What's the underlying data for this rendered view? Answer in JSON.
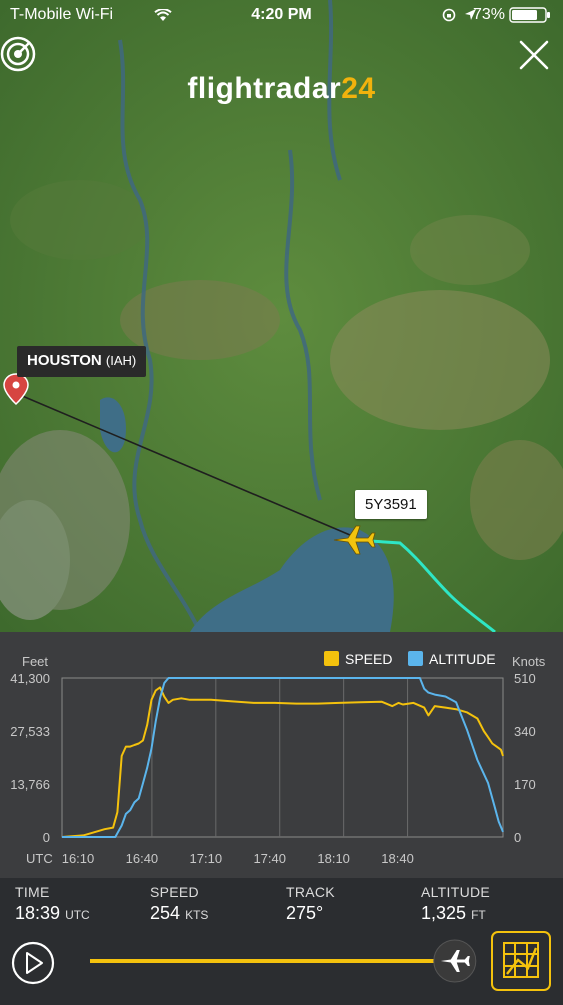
{
  "status_bar": {
    "carrier": "T-Mobile Wi-Fi",
    "time": "4:20 PM",
    "battery": "73%"
  },
  "header": {
    "logo_text": "flightradar",
    "logo_number": "24"
  },
  "map": {
    "airport_name": "HOUSTON",
    "airport_code": "(IAH)",
    "flight_label": "5Y3591",
    "track_color": "#2ee6c6",
    "plane_color": "#f1c40f"
  },
  "chart_data": {
    "type": "line",
    "x": [
      "16:10",
      "16:40",
      "17:10",
      "17:40",
      "18:10",
      "18:40"
    ],
    "xlabel": "UTC",
    "ylabel_left": "Feet",
    "ylabel_right": "Knots",
    "left_ticks": [
      "41,300",
      "27,533",
      "13,766",
      "0"
    ],
    "right_ticks": [
      "510",
      "340",
      "170",
      "0"
    ],
    "ylim_left": [
      0,
      41300
    ],
    "ylim_right": [
      0,
      510
    ],
    "series": [
      {
        "name": "SPEED",
        "color": "#f4c20d",
        "axis": "right",
        "points": [
          [
            0,
            0
          ],
          [
            10,
            5
          ],
          [
            15,
            15
          ],
          [
            20,
            25
          ],
          [
            24,
            30
          ],
          [
            26,
            80
          ],
          [
            28,
            260
          ],
          [
            30,
            290
          ],
          [
            32,
            290
          ],
          [
            34,
            295
          ],
          [
            36,
            300
          ],
          [
            38,
            310
          ],
          [
            40,
            360
          ],
          [
            42,
            440
          ],
          [
            44,
            470
          ],
          [
            46,
            480
          ],
          [
            48,
            450
          ],
          [
            50,
            430
          ],
          [
            52,
            440
          ],
          [
            56,
            445
          ],
          [
            60,
            440
          ],
          [
            70,
            440
          ],
          [
            80,
            435
          ],
          [
            90,
            430
          ],
          [
            100,
            430
          ],
          [
            110,
            428
          ],
          [
            120,
            428
          ],
          [
            130,
            430
          ],
          [
            140,
            432
          ],
          [
            150,
            434
          ],
          [
            155,
            420
          ],
          [
            158,
            430
          ],
          [
            160,
            425
          ],
          [
            165,
            430
          ],
          [
            170,
            415
          ],
          [
            172,
            390
          ],
          [
            175,
            420
          ],
          [
            180,
            415
          ],
          [
            185,
            410
          ],
          [
            190,
            400
          ],
          [
            195,
            380
          ],
          [
            198,
            340
          ],
          [
            200,
            320
          ],
          [
            202,
            300
          ],
          [
            204,
            290
          ],
          [
            206,
            280
          ],
          [
            207,
            260
          ]
        ]
      },
      {
        "name": "ALTITUDE",
        "color": "#5bb5ec",
        "axis": "left",
        "points": [
          [
            0,
            0
          ],
          [
            10,
            0
          ],
          [
            20,
            0
          ],
          [
            25,
            0
          ],
          [
            26,
            1000
          ],
          [
            28,
            3000
          ],
          [
            30,
            6000
          ],
          [
            32,
            7000
          ],
          [
            34,
            9000
          ],
          [
            36,
            10000
          ],
          [
            38,
            14000
          ],
          [
            40,
            18000
          ],
          [
            42,
            23000
          ],
          [
            44,
            30000
          ],
          [
            46,
            36000
          ],
          [
            48,
            40000
          ],
          [
            50,
            41300
          ],
          [
            100,
            41300
          ],
          [
            150,
            41300
          ],
          [
            168,
            41300
          ],
          [
            170,
            38500
          ],
          [
            172,
            37500
          ],
          [
            175,
            37000
          ],
          [
            180,
            36500
          ],
          [
            185,
            35000
          ],
          [
            190,
            28000
          ],
          [
            195,
            20000
          ],
          [
            200,
            14000
          ],
          [
            203,
            8000
          ],
          [
            205,
            4000
          ],
          [
            207,
            1325
          ]
        ]
      }
    ],
    "x_range_minutes": [
      0,
      207
    ],
    "grid": true,
    "legend": "top-right"
  },
  "stats": {
    "time_label": "TIME",
    "time_value": "18:39",
    "time_unit": "UTC",
    "speed_label": "SPEED",
    "speed_value": "254",
    "speed_unit": "KTS",
    "track_label": "TRACK",
    "track_value": "275°",
    "altitude_label": "ALTITUDE",
    "altitude_value": "1,325",
    "altitude_unit": "FT"
  },
  "playback": {
    "progress": 0.96,
    "accent": "#f4c20d"
  }
}
